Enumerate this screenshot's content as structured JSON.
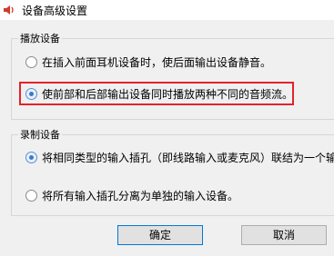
{
  "window": {
    "title": "设备高级设置",
    "icon": "speaker-icon"
  },
  "playback": {
    "group_label": "播放设备",
    "options": [
      {
        "label": "在插入前面耳机设备时，使后面输出设备静音。",
        "checked": false
      },
      {
        "label": "使前部和后部输出设备同时播放两种不同的音频流。",
        "checked": true
      }
    ]
  },
  "recording": {
    "group_label": "录制设备",
    "options": [
      {
        "label": "将相同类型的输入插孔（即线路输入或麦克风）联结为一个输",
        "checked": true
      },
      {
        "label": "将所有输入插孔分离为单独的输入设备。",
        "checked": false
      }
    ]
  },
  "buttons": {
    "ok": "确定",
    "cancel": "取消"
  },
  "colors": {
    "highlight": "#e3232a",
    "accent": "#3b79c9"
  }
}
